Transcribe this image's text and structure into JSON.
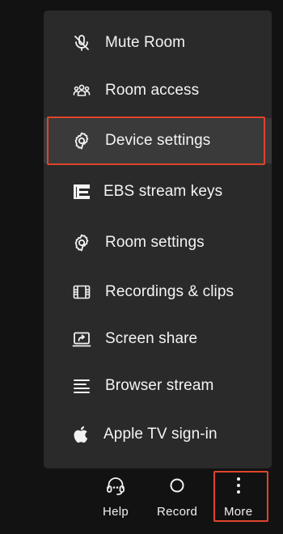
{
  "menu": {
    "items": [
      {
        "label": "Mute Room",
        "icon": "mute-room-icon"
      },
      {
        "label": "Room access",
        "icon": "people-icon"
      },
      {
        "label": "Device settings",
        "icon": "gear-icon"
      },
      {
        "label": "EBS stream keys",
        "icon": "ebs-logo-icon"
      },
      {
        "label": "Room settings",
        "icon": "gear-icon"
      },
      {
        "label": "Recordings & clips",
        "icon": "film-icon"
      },
      {
        "label": "Screen share",
        "icon": "screen-share-icon"
      },
      {
        "label": "Browser stream",
        "icon": "lines-icon"
      },
      {
        "label": "Apple TV sign-in",
        "icon": "apple-icon"
      }
    ]
  },
  "toolbar": {
    "help_label": "Help",
    "record_label": "Record",
    "more_label": "More"
  },
  "colors": {
    "background": "#121212",
    "menu_background": "#2a2a2a",
    "highlight_border": "#e0452b"
  }
}
